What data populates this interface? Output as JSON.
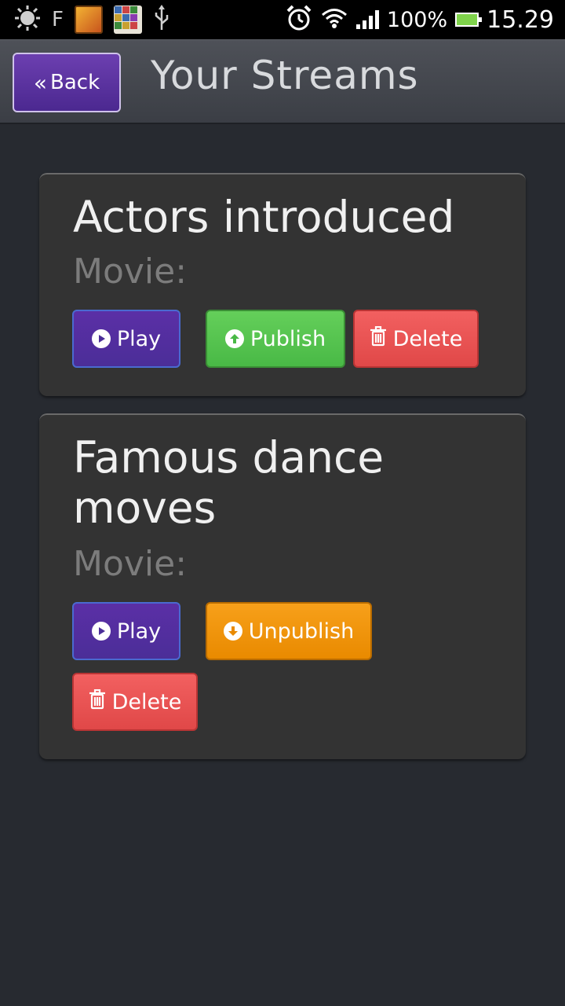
{
  "status_bar": {
    "icons": [
      "brightness-icon",
      "f-icon",
      "bike-game-icon",
      "word-game-icon",
      "usb-icon",
      "alarm-icon",
      "wifi-icon",
      "signal-icon",
      "battery-icon"
    ],
    "f_label": "F",
    "battery_percent": "100%",
    "time": "15.29"
  },
  "header": {
    "back_label": "Back",
    "title": "Your Streams"
  },
  "streams": [
    {
      "title": "Actors introduced",
      "type_label": "Movie:",
      "play_label": "Play",
      "publish_label": "Publish",
      "delete_label": "Delete"
    },
    {
      "title": "Famous dance moves",
      "type_label": "Movie:",
      "play_label": "Play",
      "unpublish_label": "Unpublish",
      "delete_label": "Delete"
    }
  ],
  "colors": {
    "background": "#272a30",
    "card": "#333333",
    "play": "#5b2fa6",
    "publish": "#58c44f",
    "delete": "#e95454",
    "unpublish": "#f29511"
  }
}
